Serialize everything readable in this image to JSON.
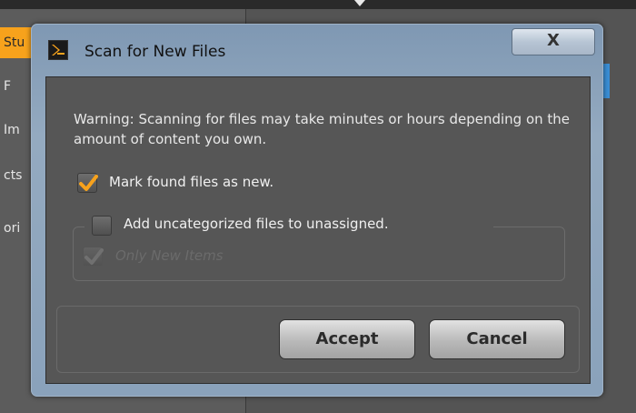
{
  "background": {
    "sidebar_items": [
      "Stu",
      "F",
      "Im",
      "cts",
      "ori"
    ]
  },
  "dialog": {
    "title": "Scan for New Files",
    "close_label": "X",
    "warning": "Warning: Scanning for files may take minutes or hours depending on the amount of content you own.",
    "options": {
      "mark_new": {
        "label": "Mark found files as new.",
        "checked": true
      },
      "add_uncategorized": {
        "label": "Add uncategorized files to unassigned.",
        "checked": false
      },
      "only_new": {
        "label": "Only New Items",
        "checked": true,
        "enabled": false
      }
    },
    "accept_label": "Accept",
    "cancel_label": "Cancel"
  },
  "colors": {
    "accent_orange": "#f7a21c",
    "highlight_blue": "#3b8fd6",
    "dialog_frame": "#8aa2bb"
  }
}
